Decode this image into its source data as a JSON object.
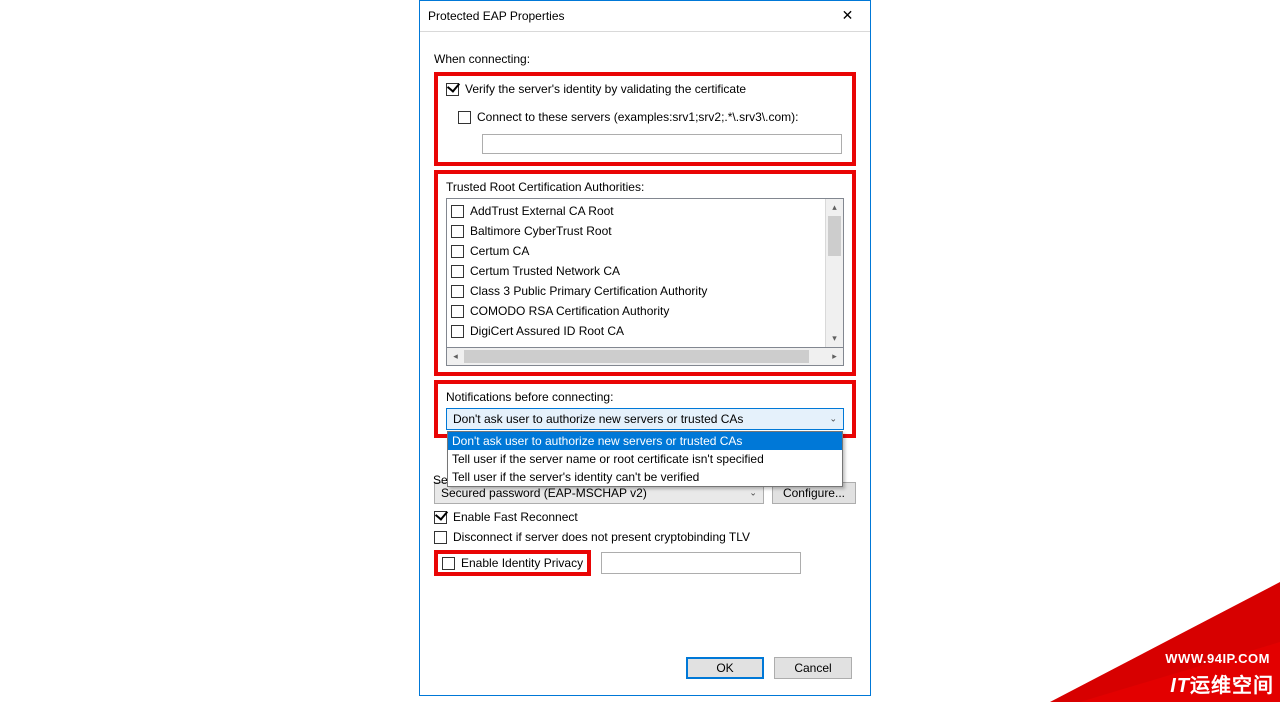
{
  "dialog": {
    "title": "Protected EAP Properties"
  },
  "labels": {
    "when_connecting": "When connecting:",
    "verify_identity": "Verify the server's identity by validating the certificate",
    "connect_servers": "Connect to these servers (examples:srv1;srv2;.*\\.srv3\\.com):",
    "trusted_root": "Trusted Root Certification Authorities:",
    "notifications": "Notifications before connecting:",
    "auth_method_prefix": "Se",
    "configure": "Configure...",
    "fast_reconnect": "Enable Fast Reconnect",
    "disconnect_crypto": "Disconnect if server does not present cryptobinding TLV",
    "identity_privacy": "Enable Identity Privacy",
    "ok": "OK",
    "cancel": "Cancel"
  },
  "servers_value": "",
  "trusted_cas": [
    "AddTrust External CA Root",
    "Baltimore CyberTrust Root",
    "Certum CA",
    "Certum Trusted Network CA",
    "Class 3 Public Primary Certification Authority",
    "COMODO RSA Certification Authority",
    "DigiCert Assured ID Root CA"
  ],
  "notifications": {
    "selected": "Don't ask user to authorize new servers or trusted CAs",
    "options": [
      "Don't ask user to authorize new servers or trusted CAs",
      "Tell user if the server name or root certificate isn't specified",
      "Tell user if the server's identity can't be verified"
    ]
  },
  "auth_method": {
    "selected": "Secured password (EAP-MSCHAP v2)"
  },
  "checks": {
    "verify_identity": true,
    "connect_servers": false,
    "fast_reconnect": true,
    "disconnect_crypto": false,
    "identity_privacy": false
  },
  "watermark": {
    "url": "WWW.94IP.COM",
    "brand": "IT运维空间"
  }
}
